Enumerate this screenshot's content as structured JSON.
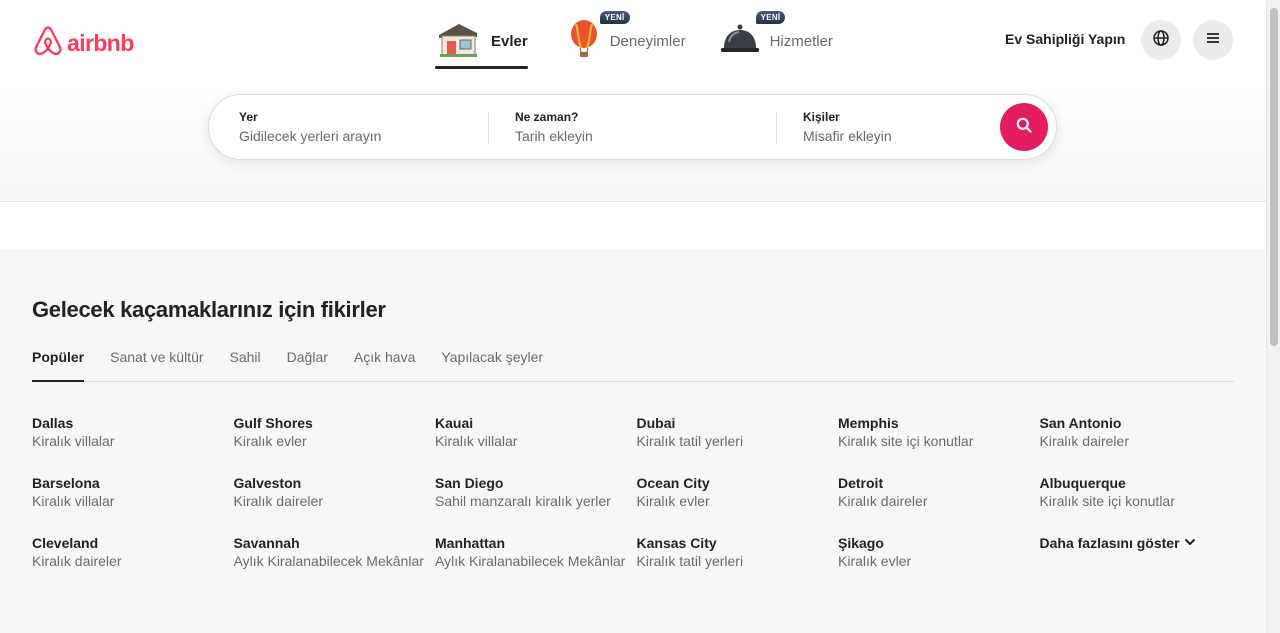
{
  "brand": {
    "name": "airbnb",
    "color": "#FF385C"
  },
  "nav": {
    "tabs": [
      {
        "label": "Evler",
        "icon": "house-icon",
        "badge": "",
        "active": true
      },
      {
        "label": "Deneyimler",
        "icon": "hot-air-balloon-icon",
        "badge": "YENİ",
        "active": false
      },
      {
        "label": "Hizmetler",
        "icon": "service-bell-icon",
        "badge": "YENİ",
        "active": false
      }
    ],
    "host_label": "Ev Sahipliği Yapın",
    "globe_icon": "globe-icon",
    "menu_icon": "menu-icon"
  },
  "search": {
    "where": {
      "title": "Yer",
      "placeholder": "Gidilecek yerleri arayın"
    },
    "when": {
      "title": "Ne zaman?",
      "placeholder": "Tarih ekleyin"
    },
    "who": {
      "title": "Kişiler",
      "placeholder": "Misafir ekleyin"
    },
    "button_icon": "search-icon",
    "button_color": "#E31C5F"
  },
  "inspiration": {
    "heading": "Gelecek kaçamaklarınız için fikirler",
    "tabs": [
      "Popüler",
      "Sanat ve kültür",
      "Sahil",
      "Dağlar",
      "Açık hava",
      "Yapılacak şeyler"
    ],
    "active_tab": "Popüler",
    "destinations": [
      {
        "city": "Dallas",
        "type": "Kiralık villalar"
      },
      {
        "city": "Gulf Shores",
        "type": "Kiralık evler"
      },
      {
        "city": "Kauai",
        "type": "Kiralık villalar"
      },
      {
        "city": "Dubai",
        "type": "Kiralık tatil yerleri"
      },
      {
        "city": "Memphis",
        "type": "Kiralık site içi konutlar"
      },
      {
        "city": "San Antonio",
        "type": "Kiralık daireler"
      },
      {
        "city": "Barselona",
        "type": "Kiralık villalar"
      },
      {
        "city": "Galveston",
        "type": "Kiralık daireler"
      },
      {
        "city": "San Diego",
        "type": "Sahil manzaralı kiralık yerler"
      },
      {
        "city": "Ocean City",
        "type": "Kiralık evler"
      },
      {
        "city": "Detroit",
        "type": "Kiralık daireler"
      },
      {
        "city": "Albuquerque",
        "type": "Kiralık site içi konutlar"
      },
      {
        "city": "Cleveland",
        "type": "Kiralık daireler"
      },
      {
        "city": "Savannah",
        "type": "Aylık Kiralanabilecek Mekânlar"
      },
      {
        "city": "Manhattan",
        "type": "Aylık Kiralanabilecek Mekânlar"
      },
      {
        "city": "Kansas City",
        "type": "Kiralık tatil yerleri"
      },
      {
        "city": "Şikago",
        "type": "Kiralık evler"
      }
    ],
    "show_more_label": "Daha fazlasını göster",
    "show_more_icon": "chevron-down-icon"
  }
}
